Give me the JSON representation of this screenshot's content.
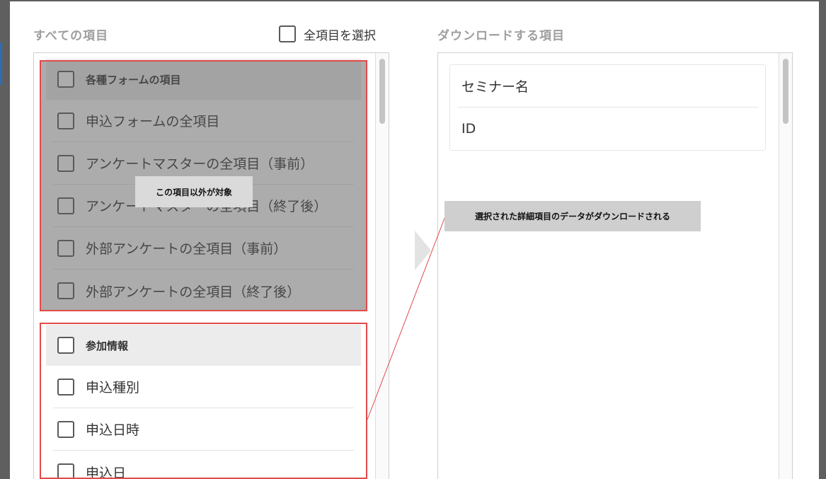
{
  "left_panel": {
    "title": "すべての項目",
    "select_all_label": "全項目を選択",
    "groups": [
      {
        "header": "各種フォームの項目",
        "items": [
          "申込フォームの全項目",
          "アンケートマスターの全項目（事前）",
          "アンケートマスターの全項目（終了後）",
          "外部アンケートの全項目（事前）",
          "外部アンケートの全項目（終了後）"
        ]
      },
      {
        "header": "参加情報",
        "items": [
          "申込種別",
          "申込日時",
          "申込日"
        ]
      }
    ]
  },
  "right_panel": {
    "title": "ダウンロードする項目",
    "items": [
      "セミナー名",
      "ID"
    ]
  },
  "annotations": {
    "excluded_note": "この項目以外が対象",
    "download_note": "選択された詳細項目のデータがダウンロードされる"
  },
  "colors": {
    "annotation_frame": "#e24a4a",
    "title_gray": "#9e9e9e"
  }
}
